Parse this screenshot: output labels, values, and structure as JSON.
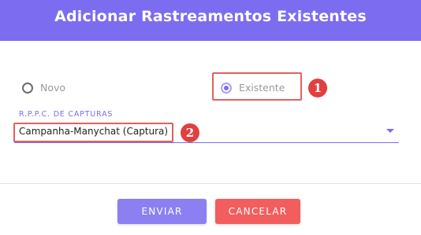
{
  "header": {
    "title": "Adicionar Rastreamentos Existentes"
  },
  "radio_group": {
    "options": [
      {
        "label": "Novo",
        "checked": false
      },
      {
        "label": "Existente",
        "checked": true
      }
    ]
  },
  "field": {
    "label": "R.P.P.C. DE CAPTURAS",
    "value": "Campanha-Manychat (Captura)"
  },
  "annotations": {
    "badge_1": "1",
    "badge_2": "2",
    "color": "#e0403f"
  },
  "buttons": {
    "submit": "ENVIAR",
    "cancel": "CANCELAR"
  },
  "colors": {
    "accent": "#7b6cf0",
    "danger": "#f25e5e"
  }
}
